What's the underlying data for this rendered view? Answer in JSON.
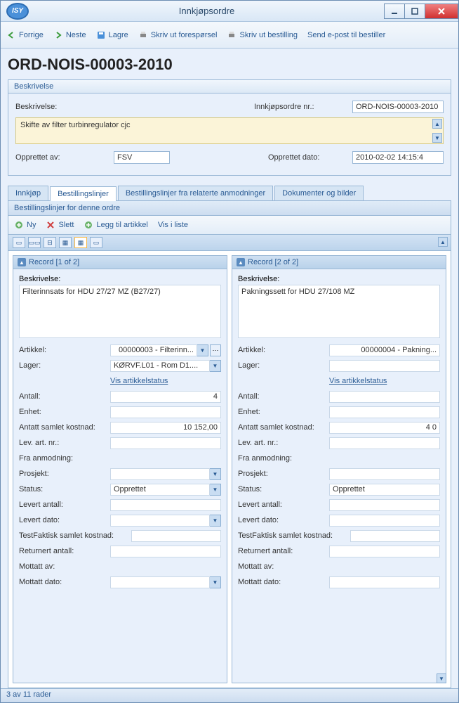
{
  "window": {
    "title": "Innkjøpsordre",
    "logo": "ISY"
  },
  "toolbar": {
    "prev": "Forrige",
    "next": "Neste",
    "save": "Lagre",
    "print_req": "Skriv ut forespørsel",
    "print_order": "Skriv ut bestilling",
    "send_email": "Send e-post til bestiller"
  },
  "page_title": "ORD-NOIS-00003-2010",
  "desc_group": {
    "title": "Beskrivelse",
    "desc_label": "Beskrivelse:",
    "order_no_label": "Innkjøpsordre nr.:",
    "order_no_value": "ORD-NOIS-00003-2010",
    "desc_value": "Skifte av filter turbinregulator cjc",
    "created_by_label": "Opprettet av:",
    "created_by_value": "FSV",
    "created_date_label": "Opprettet dato:",
    "created_date_value": "2010-02-02 14:15:4"
  },
  "tabs": {
    "t1": "Innkjøp",
    "t2": "Bestillingslinjer",
    "t3": "Bestillingslinjer fra relaterte anmodninger",
    "t4": "Dokumenter og bilder"
  },
  "subheader": "Bestillingslinjer for denne ordre",
  "subtoolbar": {
    "new": "Ny",
    "delete": "Slett",
    "add_article": "Legg til artikkel",
    "view_list": "Vis i liste"
  },
  "labels": {
    "beskrivelse": "Beskrivelse:",
    "artikkel": "Artikkel:",
    "lager": "Lager:",
    "vis_artikkelstatus": "Vis artikkelstatus",
    "antall": "Antall:",
    "enhet": "Enhet:",
    "antatt": "Antatt samlet kostnad:",
    "levart": "Lev. art. nr.:",
    "fra_anm": "Fra anmodning:",
    "prosjekt": "Prosjekt:",
    "status": "Status:",
    "lev_antall": "Levert antall:",
    "lev_dato": "Levert dato:",
    "testfaktisk": "TestFaktisk samlet kostnad:",
    "returnert": "Returnert antall:",
    "mottatt_av": "Mottatt av:",
    "mottatt_dato": "Mottatt dato:"
  },
  "records": [
    {
      "header": "Record [1 of 2]",
      "beskrivelse": "Filterinnsats for HDU 27/27 MZ (B27/27)",
      "artikkel": "00000003 - Filterinn...",
      "lager": "KØRVF.L01 - Rom D1....",
      "antall": "4",
      "antatt": "10 152,00",
      "status": "Opprettet"
    },
    {
      "header": "Record [2 of 2]",
      "beskrivelse": "Pakningssett for HDU 27/108 MZ",
      "artikkel": "00000004 - Pakning...",
      "lager": "",
      "antall": "",
      "antatt": "4 0",
      "status": "Opprettet"
    }
  ],
  "statusbar": "3 av 11 rader"
}
